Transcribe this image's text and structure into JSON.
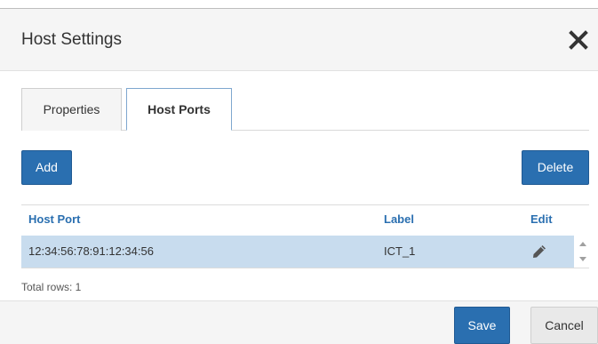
{
  "dialog": {
    "title": "Host Settings",
    "close_icon": "close-icon"
  },
  "tabs": [
    {
      "label": "Properties",
      "active": false
    },
    {
      "label": "Host Ports",
      "active": true
    }
  ],
  "toolbar": {
    "add_label": "Add",
    "delete_label": "Delete"
  },
  "table": {
    "columns": [
      "Host Port",
      "Label",
      "Edit"
    ],
    "rows": [
      {
        "host_port": "12:34:56:78:91:12:34:56",
        "label": "ICT_1",
        "edit_icon": "pencil-icon",
        "selected": true
      }
    ],
    "total_rows_text": "Total rows: 1"
  },
  "footer": {
    "save_label": "Save",
    "cancel_label": "Cancel"
  },
  "colors": {
    "accent": "#2a6fb0",
    "selected_row": "#c8dcee",
    "header_bg": "#f5f5f5"
  }
}
